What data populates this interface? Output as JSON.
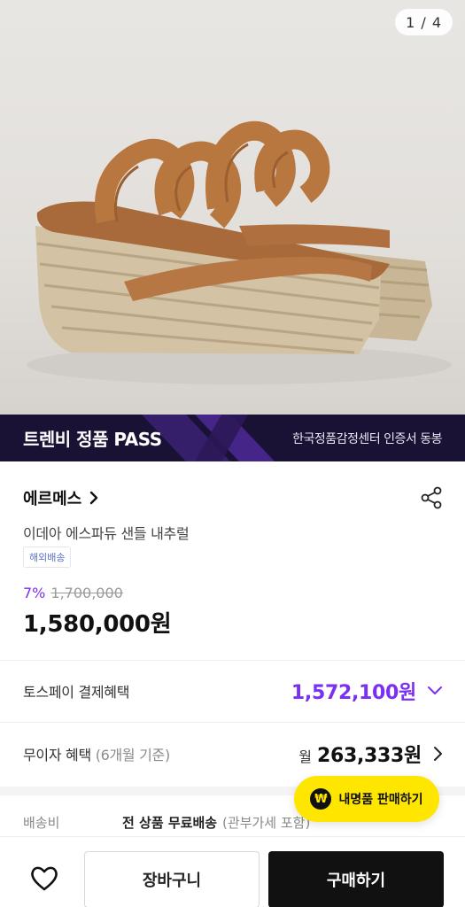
{
  "gallery": {
    "counter": "1 / 4"
  },
  "banner": {
    "title": "트렌비 정품 PASS",
    "subtitle": "한국정품감정센터 인증서 동봉"
  },
  "product": {
    "brand": "에르메스",
    "name": "이데아 에스파듀 샌들 내추럴",
    "badge": "해외배송",
    "discount": "7%",
    "original_price": "1,700,000",
    "price": "1,580,000원"
  },
  "benefits": {
    "tosspay_label": "토스페이 결제혜택",
    "tosspay_value": "1,572,100원",
    "installment_label": "무이자 혜택",
    "installment_note": "(6개월 기준)",
    "installment_prefix": "월",
    "installment_value": "263,333원"
  },
  "shipping": {
    "label": "배송비",
    "main": "전 상품 무료배송",
    "note": "(관부가세 포함)"
  },
  "fab": {
    "icon_text": "₩",
    "label": "내명품 판매하기"
  },
  "bottom_bar": {
    "cart_label": "장바구니",
    "buy_label": "구매하기"
  },
  "colors": {
    "accent_purple": "#7b2ff0",
    "fab_yellow": "#ffe600",
    "banner_bg": "#1a1235"
  },
  "icons": [
    "chevron-right-icon",
    "share-icon",
    "chevron-down-icon",
    "won-icon",
    "heart-icon"
  ]
}
